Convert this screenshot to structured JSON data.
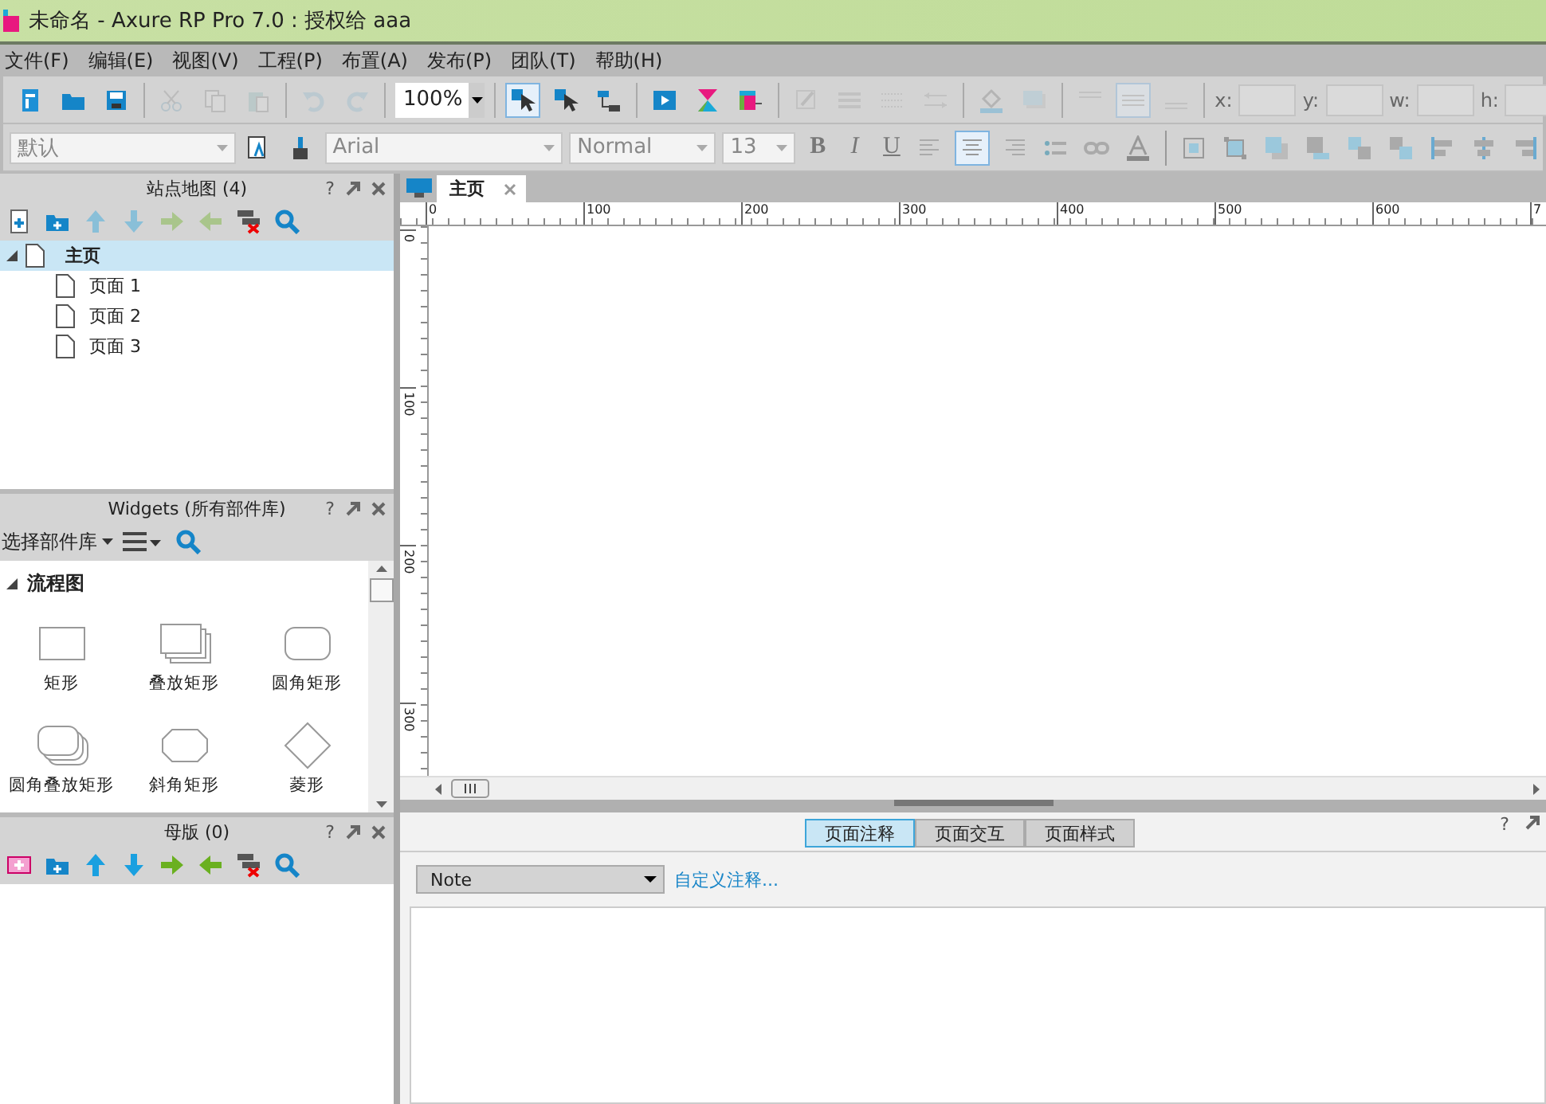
{
  "window": {
    "title": "未命名 - Axure RP Pro 7.0 : 授权给 aaa"
  },
  "menu": [
    "文件(F)",
    "编辑(E)",
    "视图(V)",
    "工程(P)",
    "布置(A)",
    "发布(P)",
    "团队(T)",
    "帮助(H)"
  ],
  "toolbar": {
    "groups": [
      [
        {
          "kind": "page",
          "disabled": false,
          "selected": false
        },
        {
          "kind": "folder",
          "disabled": false,
          "selected": false
        },
        {
          "kind": "save",
          "disabled": false,
          "selected": false
        }
      ],
      [
        {
          "kind": "scissors",
          "disabled": true,
          "selected": false
        },
        {
          "kind": "copy",
          "disabled": true,
          "selected": false
        },
        {
          "kind": "paste",
          "disabled": true,
          "selected": false
        }
      ],
      [
        {
          "kind": "undo",
          "disabled": true,
          "selected": false
        },
        {
          "kind": "redo",
          "disabled": true,
          "selected": false
        }
      ],
      [
        {
          "kind": "zoom"
        }
      ],
      [
        {
          "kind": "pointer",
          "disabled": false,
          "selected": true
        },
        {
          "kind": "pointer",
          "disabled": false,
          "selected": false
        },
        {
          "kind": "connector",
          "disabled": false,
          "selected": false
        }
      ],
      [
        {
          "kind": "play",
          "disabled": false,
          "selected": false
        },
        {
          "kind": "hourglass",
          "disabled": false,
          "selected": false
        },
        {
          "kind": "layout",
          "disabled": false,
          "selected": false
        }
      ],
      [
        {
          "kind": "pen",
          "disabled": true,
          "selected": false
        },
        {
          "kind": "lines",
          "disabled": true,
          "selected": false
        },
        {
          "kind": "dots",
          "disabled": true,
          "selected": false
        },
        {
          "kind": "arrows",
          "disabled": true,
          "selected": false
        }
      ],
      [
        {
          "kind": "bucket",
          "disabled": true,
          "selected": false
        },
        {
          "kind": "shadow",
          "disabled": true,
          "selected": false
        }
      ],
      [
        {
          "kind": "align-top",
          "disabled": true,
          "selected": false
        },
        {
          "kind": "align-middle",
          "disabled": true,
          "selected": true
        },
        {
          "kind": "align-bottom",
          "disabled": true,
          "selected": false
        }
      ]
    ],
    "zoom": "100%",
    "coords": [
      "x:",
      "y:",
      "w:",
      "h:"
    ]
  },
  "format_bar": {
    "style": "默认",
    "font": "Arial",
    "weight": "Normal",
    "size": "13",
    "buttons": [
      {
        "kind": "bold",
        "label": "B",
        "selected": false
      },
      {
        "kind": "italic",
        "label": "I",
        "selected": false
      },
      {
        "kind": "underline",
        "label": "U",
        "selected": false
      },
      {
        "kind": "left",
        "selected": false
      },
      {
        "kind": "center",
        "selected": true
      },
      {
        "kind": "right",
        "selected": false
      },
      {
        "kind": "bullets",
        "selected": false
      },
      {
        "kind": "link",
        "selected": false
      },
      {
        "kind": "font-color",
        "selected": false
      }
    ],
    "arrange": [
      {
        "kind": "group"
      },
      {
        "kind": "ungroup"
      },
      {
        "kind": "front"
      },
      {
        "kind": "back"
      },
      {
        "kind": "forward"
      },
      {
        "kind": "backward"
      },
      {
        "kind": "align-left"
      },
      {
        "kind": "align-center"
      },
      {
        "kind": "align-right"
      }
    ]
  },
  "help": "?",
  "sitemap": {
    "title": "站点地图 (4)",
    "tree": [
      {
        "label": "主页",
        "selected": true,
        "expanded": true,
        "children": [
          {
            "label": "页面 1",
            "selected": false
          },
          {
            "label": "页面 2",
            "selected": false
          },
          {
            "label": "页面 3",
            "selected": false
          }
        ]
      }
    ]
  },
  "widgets": {
    "title": "Widgets (所有部件库)",
    "library": "选择部件库",
    "section": {
      "label": "流程图",
      "expanded": true
    },
    "items": [
      {
        "kind": "rect",
        "label": "矩形"
      },
      {
        "kind": "stack",
        "label": "叠放矩形"
      },
      {
        "kind": "round",
        "label": "圆角矩形"
      },
      {
        "kind": "round-stack",
        "label": "圆角叠放矩形"
      },
      {
        "kind": "bevel",
        "label": "斜角矩形"
      },
      {
        "kind": "diamond",
        "label": "菱形"
      }
    ]
  },
  "masters": {
    "title": "母版 (0)"
  },
  "editor": {
    "tab": "主页",
    "hruler": [
      "0",
      "100",
      "200",
      "300",
      "400",
      "500",
      "600",
      "7"
    ],
    "vruler": [
      "0",
      "100",
      "200",
      "300"
    ]
  },
  "notes": {
    "tabs": [
      {
        "label": "页面注释",
        "selected": true
      },
      {
        "label": "页面交互",
        "selected": false
      },
      {
        "label": "页面样式",
        "selected": false
      }
    ],
    "dropdown": "Note",
    "link": "自定义注释..."
  }
}
